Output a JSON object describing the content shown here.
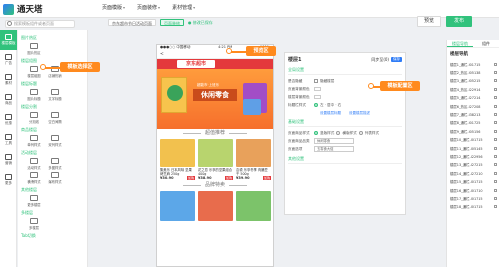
{
  "app": {
    "name": "通天塔"
  },
  "topnav": [
    "页面模版",
    "页面装修",
    "素材管理"
  ],
  "search": {
    "placeholder": "搜索模板组件或者页面"
  },
  "subbar": {
    "page_select": "京东超市节日活动页面",
    "mode_select": "页面装修",
    "status": "● 修改已保存"
  },
  "actions": {
    "preview": "预览",
    "publish": "发布"
  },
  "rail": [
    {
      "label": "楼层模板",
      "icon": "layers-icon",
      "active": true
    },
    {
      "label": "广告",
      "icon": "ad-icon",
      "active": false
    },
    {
      "label": "素材",
      "icon": "image-icon",
      "active": false
    },
    {
      "label": "商品",
      "icon": "goods-icon",
      "active": false
    },
    {
      "label": "优惠",
      "icon": "coupon-icon",
      "active": false
    },
    {
      "label": "工具",
      "icon": "tool-icon",
      "active": false
    },
    {
      "label": "营销",
      "icon": "marketing-icon",
      "active": false
    },
    {
      "label": "更多",
      "icon": "more-icon",
      "active": false
    }
  ],
  "modules": [
    {
      "title": "图片热区",
      "items": [
        "图片热区"
      ]
    },
    {
      "title": "楼层组图",
      "items": [
        "楼层组图",
        "店铺热销"
      ]
    },
    {
      "title": "楼层标题",
      "items": [
        "图片标题",
        "文字标题"
      ]
    },
    {
      "title": "楼层分割",
      "items": [
        "分割线",
        "空白间隔"
      ]
    },
    {
      "title": "商品楼层",
      "items": [
        "单列样式",
        "双列样式"
      ]
    },
    {
      "title": "活动楼层",
      "items": [
        "活动样式",
        "多图样式",
        "横滑样式",
        "瀑布样式"
      ]
    },
    {
      "title": "其他楼层",
      "items": [
        "更多楼层"
      ]
    },
    {
      "title": "多楼层",
      "items": [
        "多楼层"
      ]
    },
    {
      "title": "Tab切换",
      "items": []
    }
  ],
  "phone": {
    "carrier": "●●●○○ 中国移动",
    "time": "4:21 PM",
    "battery": "100%",
    "back": "<",
    "mall_tag": "京东超市",
    "hero_sub": "超能市·上班乐",
    "hero_title": "休闲零食",
    "section1": "超值推荐",
    "section2": "品牌特卖",
    "products": [
      {
        "name": "集美乐 日本风味 坚果烤芝麻 250g",
        "price": "¥30.90",
        "color": "#f2c14e"
      },
      {
        "name": "花之恋 乐享的坚果组合 400g",
        "price": "¥38.90",
        "color": "#b8d46e"
      },
      {
        "name": "嘉顿 乐享冬季 肉脯豆干 500g",
        "price": "¥39.90",
        "color": "#e8a15b"
      }
    ],
    "products2": [
      {
        "color": "#5ca7e8"
      },
      {
        "color": "#e86c4c"
      },
      {
        "color": "#7cc36a"
      }
    ],
    "buy": "加购"
  },
  "config": {
    "name": "楼层1",
    "sync_label": "同步至(0)",
    "sync_btn": "保存",
    "section1": "全局设置",
    "rows1": [
      {
        "label": "是否隐藏",
        "value": "隐藏楼层"
      },
      {
        "label": "页面背景颜色",
        "value": ""
      },
      {
        "label": "楼层背景颜色",
        "value": ""
      },
      {
        "label": "标题栏样式",
        "value": "左 · 居中 · 右"
      }
    ],
    "links": [
      "设置楼层标题",
      "设置楼层描述"
    ],
    "section2": "基础设置",
    "rows2": [
      {
        "label": "页面商品样式",
        "options": [
          "竖版样式",
          "横版样式",
          "列表样式"
        ]
      },
      {
        "label": "页面商品品类",
        "value": "休闲零食"
      },
      {
        "label": "页面选项",
        "value": "五零食大促"
      }
    ],
    "section3": "其他设置"
  },
  "rpanel": {
    "tabs": [
      "楼层导航",
      "组件"
    ],
    "title": "楼层导航",
    "rows": [
      "楼层1_通栏-I01715",
      "楼层2_热区-I05138",
      "楼层3_通栏-I05215",
      "楼层4_热区-I22914",
      "楼层5_通栏-I27214",
      "楼层6_热区-I27208",
      "楼层7_通栏-I38213",
      "楼层8_通栏-I01725",
      "楼层9_通栏-I05156",
      "楼层10_通栏-I01715",
      "楼层11_通栏-I05145",
      "楼层12_通栏-I22956",
      "楼层13_通栏-I27215",
      "楼层14_通栏-I27210",
      "楼层15_通栏-I01715",
      "楼层16_通栏-I01710",
      "楼层17_通栏-I01715",
      "楼层18_通栏-I01715"
    ]
  },
  "callouts": {
    "template_select": "模板选择区",
    "preview": "预览区",
    "config": "模板配置区"
  },
  "colors": {
    "accent": "#31c27c",
    "callout": "#ff8a1e",
    "jd_red": "#e4393c"
  }
}
